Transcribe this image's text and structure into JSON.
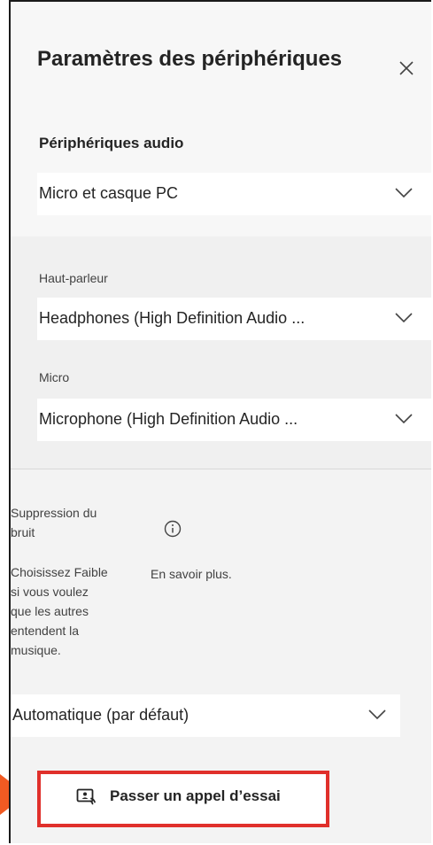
{
  "panel": {
    "title": "Paramètres des périphériques",
    "close_icon": "close-icon"
  },
  "audio_devices": {
    "label": "Périphériques audio",
    "selected": "Micro et casque PC"
  },
  "speaker": {
    "label": "Haut-parleur",
    "selected": "Headphones (High Definition Audio ..."
  },
  "microphone": {
    "label": "Micro",
    "selected": "Microphone (High Definition Audio ..."
  },
  "noise_suppression": {
    "label_line1": "Suppression du",
    "label_line2": "bruit",
    "desc_lines": [
      "Choisissez Faible",
      "si vous voulez",
      "que les autres",
      "entendent la",
      "musique."
    ],
    "learn_more": "En savoir plus.",
    "selected": "Automatique (par défaut)"
  },
  "test_call": {
    "label": "Passer un appel d’essai",
    "icon": "test-call-icon"
  },
  "colors": {
    "highlight_border": "#e0302b",
    "arrow": "#f15a22"
  }
}
